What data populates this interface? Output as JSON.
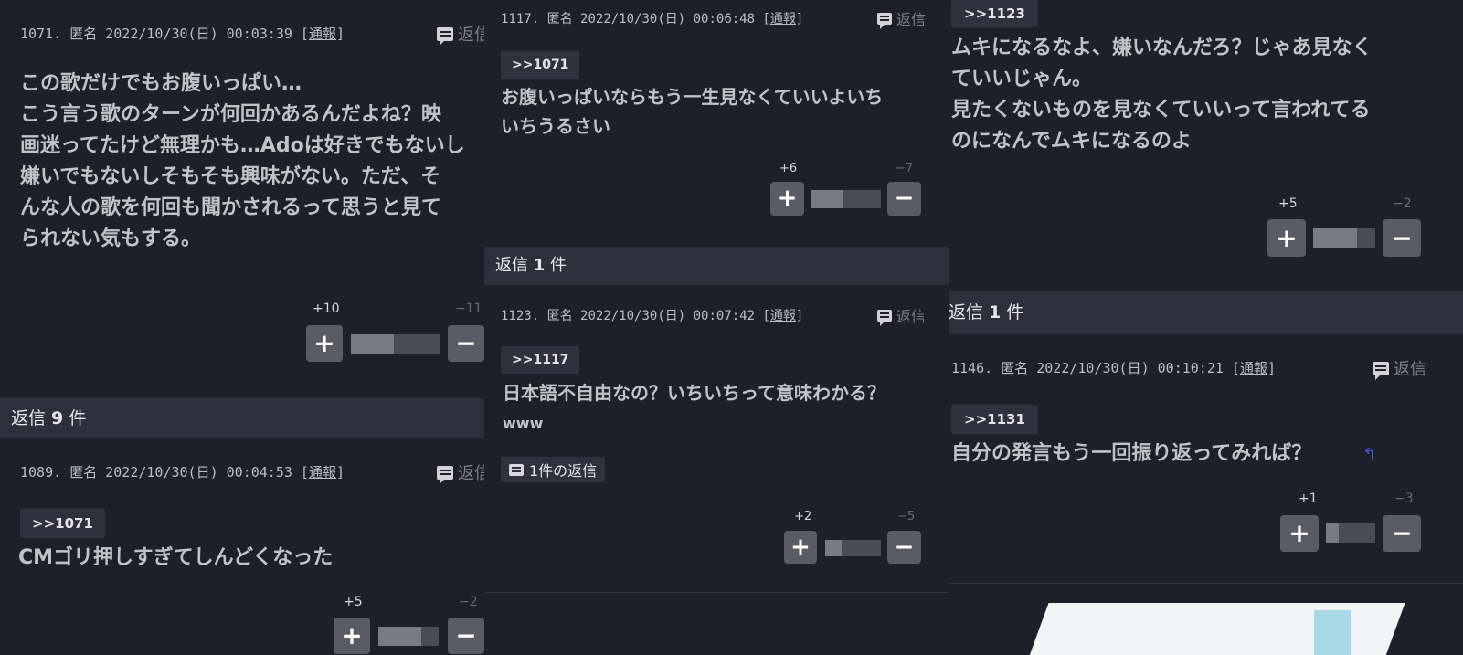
{
  "col_a": {
    "posts": [
      {
        "meta": {
          "num": "1071.",
          "name": "匿名",
          "datetime": "2022/10/30(日) 00:03:39",
          "open": "[",
          "report": "通報",
          "close": "]"
        },
        "reply_link": "返信",
        "body": [
          "この歌だけでもお腹いっぱい…",
          "こう言う歌のターンが何回かあるんだよね？映",
          "画迷ってたけど無理かも…Adoは好きでもないし",
          "嫌いでもないしそもそも興味がない。ただ、そ",
          "んな人の歌を何回も聞かされるって思うと見て",
          "られない気もする。"
        ],
        "vote": {
          "plus": "+10",
          "minus": "−11",
          "up_fraction": 0.48
        }
      },
      {
        "meta": {
          "num": "1089.",
          "name": "匿名",
          "datetime": "2022/10/30(日) 00:04:53",
          "open": "[",
          "report": "通報",
          "close": "]"
        },
        "reply_link": "返信",
        "anchor": ">>1071",
        "body": [
          "CMゴリ押しすぎてしんどくなった"
        ],
        "vote": {
          "plus": "+5",
          "minus": "−2",
          "up_fraction": 0.71
        }
      }
    ],
    "replies_header": {
      "prefix": "返信 ",
      "count": "9",
      "suffix": " 件"
    }
  },
  "col_b": {
    "posts": [
      {
        "meta": {
          "num": "1117.",
          "name": "匿名",
          "datetime": "2022/10/30(日) 00:06:48",
          "open": "[",
          "report": "通報",
          "close": "]"
        },
        "reply_link": "返信",
        "anchor": ">>1071",
        "body": [
          "お腹いっぱいならもう一生見なくていいよいち",
          "いちうるさい"
        ],
        "vote": {
          "plus": "+6",
          "minus": "−7",
          "up_fraction": 0.46
        }
      },
      {
        "meta": {
          "num": "1123.",
          "name": "匿名",
          "datetime": "2022/10/30(日) 00:07:42",
          "open": "[",
          "report": "通報",
          "close": "]"
        },
        "reply_link": "返信",
        "anchor": ">>1117",
        "body": [
          "日本語不自由なの？いちいちって意味わかる？",
          "www"
        ],
        "reply_chip": "1件の返信",
        "vote": {
          "plus": "+2",
          "minus": "−5",
          "up_fraction": 0.29
        }
      }
    ],
    "replies_header": {
      "prefix": "返信 ",
      "count": "1",
      "suffix": " 件"
    }
  },
  "col_c": {
    "posts": [
      {
        "anchor": ">>1123",
        "body": [
          "ムキになるなよ、嫌いなんだろ？じゃあ見なく",
          "ていいじゃん。",
          "見たくないものを見なくていいって言われてる",
          "のになんでムキになるのよ"
        ],
        "vote": {
          "plus": "+5",
          "minus": "−2",
          "up_fraction": 0.71
        }
      },
      {
        "meta": {
          "num": "1146.",
          "name": "匿名",
          "datetime": "2022/10/30(日) 00:10:21",
          "open": "[",
          "report": "通報",
          "close": "]"
        },
        "reply_link": "返信",
        "anchor": ">>1131",
        "body": [
          "自分の発言もう一回振り返ってみれば？"
        ],
        "vote": {
          "plus": "+1",
          "minus": "−3",
          "up_fraction": 0.25
        }
      }
    ],
    "replies_header": {
      "prefix": "返信 ",
      "count": "1",
      "suffix": " 件"
    }
  },
  "vote_icons": {
    "plus": "+",
    "minus": "−"
  }
}
